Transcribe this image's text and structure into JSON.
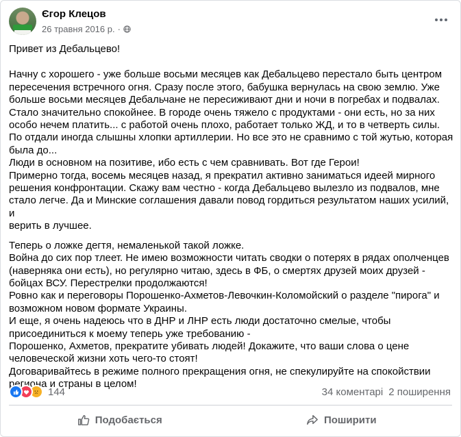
{
  "post": {
    "author": "Єгор Клецов",
    "date": "26 травня 2016 р.",
    "dot": "·",
    "paragraphs": [
      {
        "lines": [
          "Привет из Дебальцево!"
        ]
      },
      {
        "lines": [
          "Начну с хорошего - уже больше восьми месяцев как Дебальцево перестало быть центром",
          "пересечения встречного огня. Сразу после этого, бабушка вернулась на свою землю. Уже",
          "больше восьми месяцев Дебальчане не пересиживают дни и ночи в погребах и подвалах.",
          "Стало значительно спокойнее. В городе очень тяжело с продуктами - они есть, но за них",
          "особо нечем платить... с работой очень плохо, работает только ЖД, и то в четверть силы.",
          "По отдали иногда слышны хлопки артиллерии. Но все это не сравнимо с той жутью, которая",
          "была до...",
          "Люди в основном на позитиве, ибо есть с чем сравнивать. Вот где Герои!",
          "Примерно тогда, восемь месяцев назад, я прекратил активно заниматься идеей мирного",
          "решения конфронтации. Скажу вам честно - когда Дебальцево вылезло из подвалов, мне",
          "стало легче. Да и Минские соглашения давали повод гордиться результатом наших усилий, и",
          "верить в лучшее."
        ]
      },
      {
        "lines": [
          "Теперь о ложке дегтя, немаленькой такой ложке.",
          "Война до сих пор тлеет. Не имею возможности читать сводки о потерях в рядах ополченцев",
          "(наверняка они есть), но регулярно читаю, здесь в ФБ, о смертях друзей моих друзей -",
          "бойцах ВСУ. Перестрелки продолжаются!",
          "Ровно как и переговоры Порошенко-Ахметов-Левочкин-Коломойский о разделе \"пирога\" и",
          "возможном новом формате Украины.",
          "И еще, я очень надеюсь что в ДНР и ЛНР есть люди достаточно смелые, чтобы",
          "присоединиться к моему теперь уже требованию -",
          "Порошенко, Ахметов, прекратите убивать людей! Докажите, что ваши слова о цене",
          "человеческой жизни хоть чего-то стоят!",
          "Договаривайтесь в режиме полного прекращения огня, не спекулируйте на спокойствии",
          "региона и страны в целом!"
        ]
      }
    ]
  },
  "stats": {
    "reactions_count": "144",
    "comments": "34 коментарі",
    "shares": "2 поширення",
    "reaction_icons": [
      "like-icon",
      "love-icon",
      "sad-icon"
    ]
  },
  "actions": {
    "like_label": "Подобається",
    "share_label": "Поширити"
  },
  "colors": {
    "like": "#1877f2",
    "love": "#f33e58",
    "sad": "#f7b125",
    "secondary_text": "#65676b"
  }
}
